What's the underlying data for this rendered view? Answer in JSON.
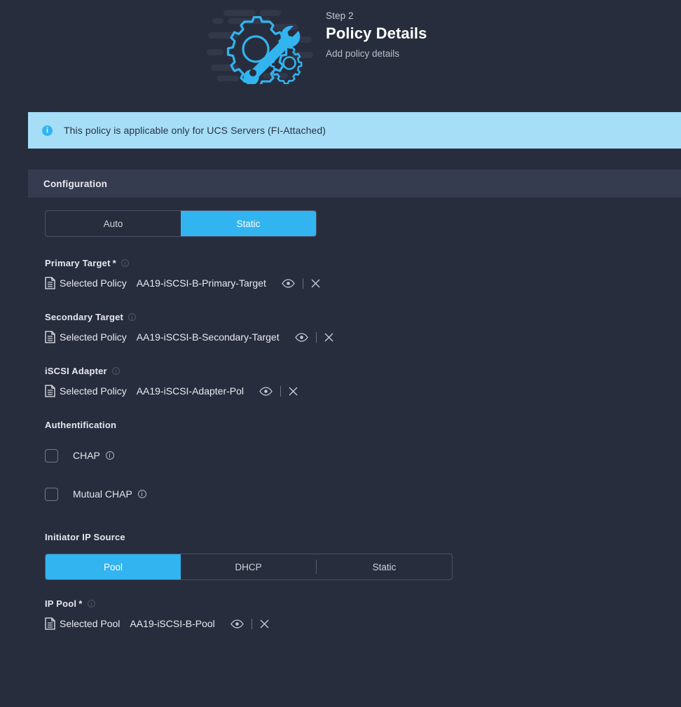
{
  "header": {
    "step_label": "Step 2",
    "title": "Policy Details",
    "subtitle": "Add policy details",
    "illustration_icon": "gear-wrench-illustration",
    "accent_color": "#32b4f0"
  },
  "banner": {
    "icon": "info-icon",
    "text": "This policy is applicable only for UCS Servers (FI-Attached)",
    "background_color": "#a6def8",
    "text_color": "#2b3142"
  },
  "section": {
    "title": "Configuration",
    "background_color": "#363c4f"
  },
  "mode_toggle": {
    "name": "mode",
    "options": [
      "Auto",
      "Static"
    ],
    "selected": "Static"
  },
  "fields": {
    "primary_target": {
      "label": "Primary Target",
      "required": true,
      "info_icon": "info-icon",
      "doc_icon": "document-icon",
      "kind": "Selected Policy",
      "value": "AA19-iSCSI-B-Primary-Target",
      "view_icon": "eye-icon",
      "clear_icon": "close-icon"
    },
    "secondary_target": {
      "label": "Secondary Target",
      "required": false,
      "info_icon": "info-icon",
      "doc_icon": "document-icon",
      "kind": "Selected Policy",
      "value": "AA19-iSCSI-B-Secondary-Target",
      "view_icon": "eye-icon",
      "clear_icon": "close-icon"
    },
    "iscsi_adapter": {
      "label": "iSCSI Adapter",
      "required": false,
      "info_icon": "info-icon",
      "doc_icon": "document-icon",
      "kind": "Selected Policy",
      "value": "AA19-iSCSI-Adapter-Pol",
      "view_icon": "eye-icon",
      "clear_icon": "close-icon"
    },
    "ip_pool": {
      "label": "IP Pool",
      "required": true,
      "info_icon": "info-icon",
      "doc_icon": "document-icon",
      "kind": "Selected Pool",
      "value": "AA19-iSCSI-B-Pool",
      "view_icon": "eye-icon",
      "clear_icon": "close-icon"
    }
  },
  "authentification": {
    "title": "Authentification",
    "checkboxes": [
      {
        "label": "CHAP",
        "checked": false,
        "info_icon": "info-icon"
      },
      {
        "label": "Mutual CHAP",
        "checked": false,
        "info_icon": "info-icon"
      }
    ]
  },
  "initiator_ip_source": {
    "title": "Initiator IP Source",
    "options": [
      "Pool",
      "DHCP",
      "Static"
    ],
    "selected": "Pool"
  }
}
